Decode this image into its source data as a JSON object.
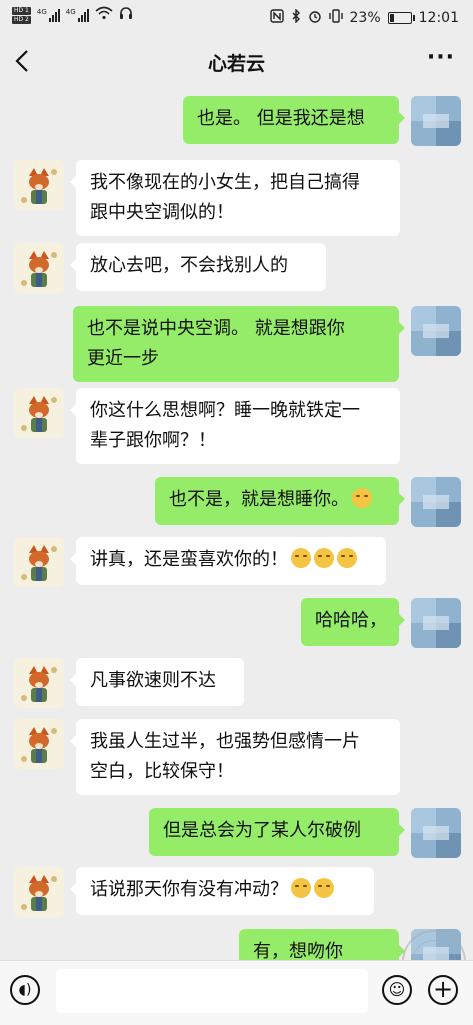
{
  "status_bar": {
    "hd1": "HD 1",
    "hd2": "HD 2",
    "net1": "4G",
    "net2": "4G",
    "battery_percent": "23%",
    "battery_level": 0.23,
    "time": "12:01"
  },
  "header": {
    "back_icon": "chevron-left-icon",
    "title": "心若云",
    "more_icon": "more-dots-icon"
  },
  "messages": [
    {
      "side": "out",
      "lines": [
        "也是。 但是我还是想"
      ]
    },
    {
      "side": "in",
      "lines": [
        "我不像现在的小女生，把自己搞得",
        "跟中央空调似的！"
      ]
    },
    {
      "side": "in",
      "lines": [
        "放心去吧，不会找别人的"
      ]
    },
    {
      "side": "out",
      "lines": [
        "也不是说中央空调。 就是想跟你",
        "更近一步"
      ]
    },
    {
      "side": "in",
      "lines": [
        "你这什么思想啊？睡一晚就铁定一",
        "辈子跟你啊？！"
      ]
    },
    {
      "side": "out",
      "lines": [
        "也不是，就是想睡你。"
      ],
      "emoji_count": 1
    },
    {
      "side": "in",
      "lines": [
        "讲真，还是蛮喜欢你的！"
      ],
      "emoji_count": 3
    },
    {
      "side": "out",
      "lines": [
        "哈哈哈，"
      ]
    },
    {
      "side": "in",
      "lines": [
        "凡事欲速则不达"
      ]
    },
    {
      "side": "in",
      "lines": [
        "我虽人生过半，也强势但感情一片",
        "空白，比较保守！"
      ]
    },
    {
      "side": "out",
      "lines": [
        "但是总会为了某人尔破例"
      ]
    },
    {
      "side": "in",
      "lines": [
        "话说那天你有没有冲动？"
      ],
      "emoji_count": 2
    },
    {
      "side": "out",
      "lines": [
        "有，想吻你"
      ]
    }
  ],
  "input_bar": {
    "voice_icon": "voice-icon",
    "input_value": "",
    "emoji_icon": "emoji-icon",
    "plus_icon": "plus-icon"
  },
  "colors": {
    "background": "#ededed",
    "bubble_out": "#95ec69",
    "bubble_in": "#ffffff"
  }
}
